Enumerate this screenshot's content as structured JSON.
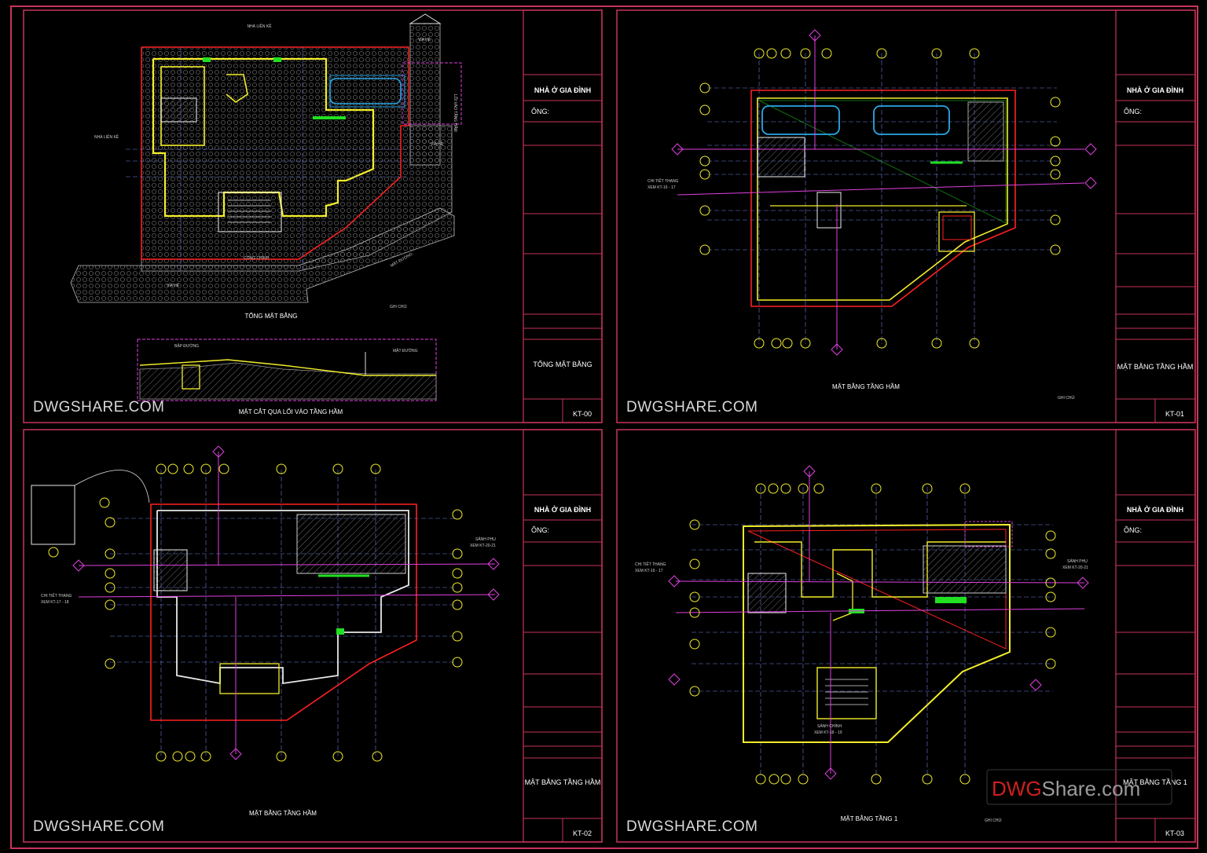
{
  "watermark": "DWGSHARE.COM",
  "corner_logo": {
    "prefix": "DWG",
    "suffix": "Share.com",
    "prefix_color": "#d01f1f",
    "suffix_color": "#9a9a9a"
  },
  "colors": {
    "frame": "#c8345a",
    "wall": "#f3ee2a",
    "wall2": "#e8e8e8",
    "dim": "#3fd7e6",
    "grid": "#6f7fe0",
    "callout": "#e040e0",
    "car": "#2aa8e8",
    "green": "#21e021",
    "red": "#ff2020",
    "hatch": "#7a7a7a"
  },
  "sheets": [
    {
      "id": "s1",
      "project": "NHÀ Ở GIA ĐÌNH",
      "owner": "ÔNG:",
      "titleblock_name": "TỔNG MẶT BẰNG",
      "code": "KT-00",
      "drawing_titles": [
        "TỔNG MẶT BẰNG",
        "MẶT CẮT QUA LỐI VÀO TẦNG HẦM"
      ]
    },
    {
      "id": "s2",
      "project": "NHÀ Ở GIA ĐÌNH",
      "owner": "ÔNG:",
      "titleblock_name": "MẶT BẰNG TẦNG HẦM",
      "code": "KT-01",
      "drawing_titles": [
        "MẶT BẰNG TẦNG HẦM"
      ]
    },
    {
      "id": "s3",
      "project": "NHÀ Ở GIA ĐÌNH",
      "owner": "ÔNG:",
      "titleblock_name": "MẶT BẰNG TẦNG HẦM",
      "code": "KT-02",
      "drawing_titles": [
        "MẶT BẰNG TẦNG HẦM"
      ]
    },
    {
      "id": "s4",
      "project": "NHÀ Ở GIA ĐÌNH",
      "owner": "ÔNG:",
      "titleblock_name": "MẶT BẰNG TẦNG 1",
      "code": "KT-03",
      "drawing_titles": [
        "MẶT BẰNG TẦNG 1"
      ]
    }
  ],
  "s1_labels": {
    "via_he_top": "VỈA HÈ",
    "nha_lien_ke_top": "NHÀ LIỀN KỀ",
    "nha_lien_ke_left": "NHÀ LIỀN KỀ",
    "loi_vao": "LỐI VÀO TẦNG HẦM",
    "via_he_right": "VỈA HÈ",
    "via_he_bottom": "VỈA HÈ",
    "cong_chinh": "CỔNG CHÍNH",
    "mat_duong": "MẶT ĐƯỜNG",
    "ghi_chu": "GHI CHÚ:",
    "bap_duong": "BẬP ĐƯỜNG",
    "mat_duong2": "MẶT ĐƯỜNG"
  },
  "s2_labels": {
    "chi_tiet": "CHI TIẾT THANG",
    "xem": "XEM KT-16 - 17",
    "ghi_chu": "GHI CHÚ:"
  },
  "s3_labels": {
    "chi_tiet": "CHI TIẾT THANG",
    "xem": "XEM KT-17 - 18",
    "sanh_phu": "SẢNH PHỤ",
    "sanh_xem": "XEM KT-20-21"
  },
  "s4_labels": {
    "chi_tiet": "CHI TIẾT THANG",
    "xem": "XEM KT-16 - 17",
    "sanh_phu": "SẢNH PHỤ",
    "sanh_xem": "XEM KT-20-21",
    "sanh_chinh": "SẢNH CHÍNH",
    "sanh_chinh_xem": "XEM KT-18 - 19",
    "ghi_chu": "GHI CHÚ:"
  }
}
